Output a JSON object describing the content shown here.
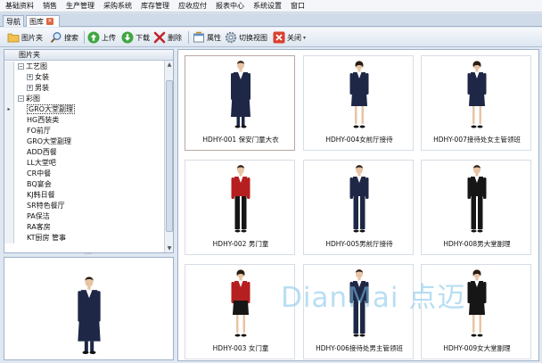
{
  "menu": [
    "基础资料",
    "销售",
    "生产管理",
    "采购系统",
    "库存管理",
    "应收应付",
    "报表中心",
    "系统设置",
    "窗口"
  ],
  "tabs": [
    {
      "label": "导航"
    },
    {
      "label": "图库"
    }
  ],
  "toolbar": {
    "folder": "图片夹",
    "search": "搜索",
    "upload": "上传",
    "download": "下载",
    "delete": "删除",
    "properties": "属性",
    "switch_view": "切换视图",
    "close": "关闭"
  },
  "tree": {
    "header": "图片夹",
    "rows": [
      {
        "label": "工艺图",
        "depth": 0,
        "expander": "−"
      },
      {
        "label": "女装",
        "depth": 1,
        "expander": "+"
      },
      {
        "label": "男装",
        "depth": 1,
        "expander": "+"
      },
      {
        "label": "彩图",
        "depth": 0,
        "expander": "−"
      },
      {
        "label": "GRO大堂副理",
        "depth": 1,
        "expander": ""
      },
      {
        "label": "HG西装类",
        "depth": 1,
        "expander": ""
      },
      {
        "label": "FO前厅",
        "depth": 1,
        "expander": ""
      },
      {
        "label": "GRO大堂副理",
        "depth": 1,
        "expander": ""
      },
      {
        "label": "ADD西餐",
        "depth": 1,
        "expander": ""
      },
      {
        "label": "LL大堂吧",
        "depth": 1,
        "expander": ""
      },
      {
        "label": "CR中餐",
        "depth": 1,
        "expander": ""
      },
      {
        "label": "BQ宴会",
        "depth": 1,
        "expander": ""
      },
      {
        "label": "KJ韩日餐",
        "depth": 1,
        "expander": ""
      },
      {
        "label": "SR特色餐厅",
        "depth": 1,
        "expander": ""
      },
      {
        "label": "PA保洁",
        "depth": 1,
        "expander": ""
      },
      {
        "label": "RA客房",
        "depth": 1,
        "expander": ""
      },
      {
        "label": "KT厨房 管事",
        "depth": 1,
        "expander": ""
      }
    ],
    "selected_index": 4,
    "row_marker": "▸"
  },
  "gallery": [
    {
      "caption": "HDHY-001 保安门童大衣",
      "figure": "long-navy-coat"
    },
    {
      "caption": "HDHY-004女前厅接待",
      "figure": "female-navy-suit"
    },
    {
      "caption": "HDHY-007接待处女主管领班",
      "figure": "female-navy-suit"
    },
    {
      "caption": "HDHY-002 男门童",
      "figure": "male-red-jacket"
    },
    {
      "caption": "HDHY-005男前厅接待",
      "figure": "male-navy-suit"
    },
    {
      "caption": "HDHY-008男大堂副理",
      "figure": "male-black-suit"
    },
    {
      "caption": "HDHY-003 女门童",
      "figure": "female-red-jacket"
    },
    {
      "caption": "HDHY-006接待处男主管领班",
      "figure": "male-navy-suit"
    },
    {
      "caption": "HDHY-009女大堂副理",
      "figure": "female-black-suit"
    }
  ],
  "watermark": "DianMai 点迈",
  "colors": {
    "navy": "#1e2746",
    "red": "#b51f1f",
    "black": "#161616",
    "accent": "#7fc4ea"
  }
}
